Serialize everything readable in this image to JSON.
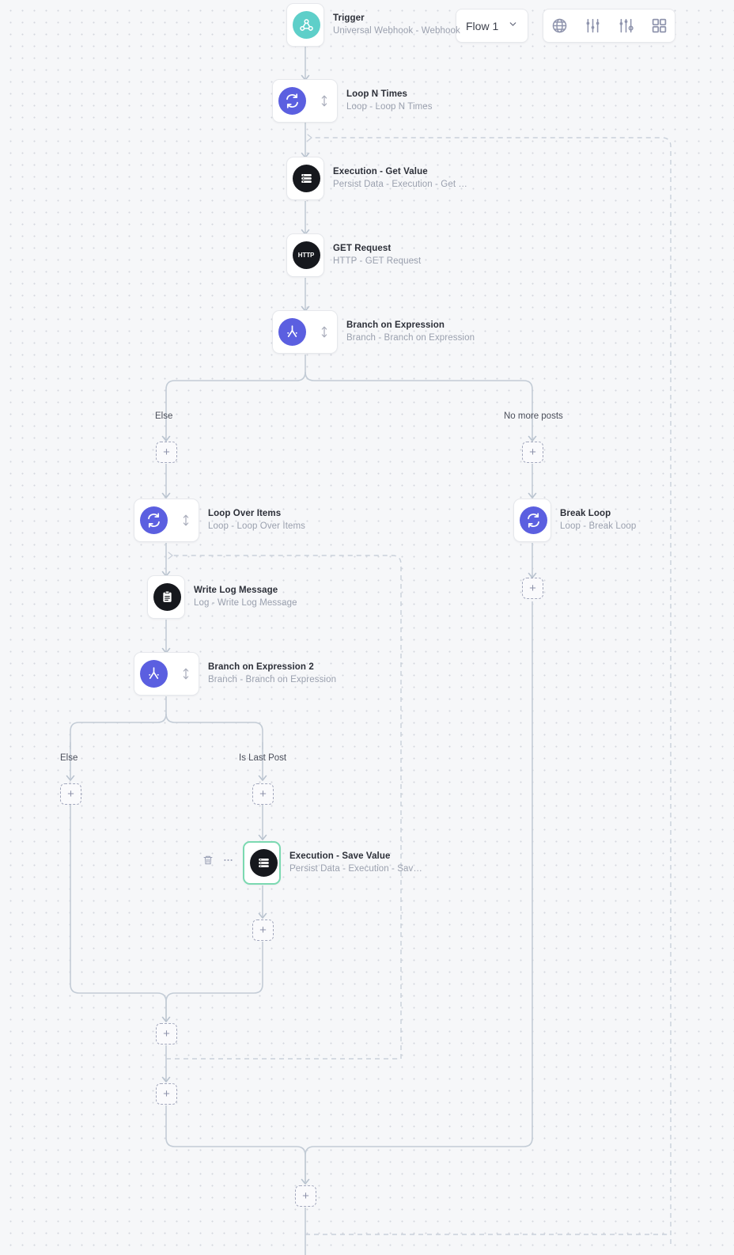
{
  "topbar": {
    "flow_select": {
      "label": "Flow 1",
      "chevron_icon": "chevron-down-icon"
    },
    "tools": [
      {
        "name": "globe-icon",
        "label": "Globe"
      },
      {
        "name": "sliders-icon",
        "label": "Settings"
      },
      {
        "name": "sliders-alt-icon",
        "label": "Advanced settings"
      },
      {
        "name": "grid-icon",
        "label": "Grid view"
      }
    ]
  },
  "nodes": [
    {
      "id": "trigger",
      "title": "Trigger",
      "subtitle": "Universal Webhook - Webhook",
      "icon": "webhook-icon",
      "icon_style": "teal",
      "handle": false,
      "selected": false
    },
    {
      "id": "loop_n_times",
      "title": "Loop N Times",
      "subtitle": "Loop - Loop N Times",
      "icon": "loop-icon",
      "icon_style": "blue",
      "handle": true,
      "selected": false
    },
    {
      "id": "exec_get",
      "title": "Execution - Get Value",
      "subtitle": "Persist Data - Execution - Get …",
      "icon": "database-icon",
      "icon_style": "dark",
      "handle": false,
      "selected": false
    },
    {
      "id": "get_request",
      "title": "GET Request",
      "subtitle": "HTTP - GET Request",
      "icon": "http-icon",
      "icon_style": "dark",
      "handle": false,
      "selected": false
    },
    {
      "id": "branch1",
      "title": "Branch on Expression",
      "subtitle": "Branch - Branch on Expression",
      "icon": "branch-icon",
      "icon_style": "blue",
      "handle": true,
      "selected": false
    },
    {
      "id": "loop_items",
      "title": "Loop Over Items",
      "subtitle": "Loop - Loop Over Items",
      "icon": "loop-icon",
      "icon_style": "blue",
      "handle": true,
      "selected": false
    },
    {
      "id": "break_loop",
      "title": "Break Loop",
      "subtitle": "Loop - Break Loop",
      "icon": "loop-icon",
      "icon_style": "blue",
      "handle": false,
      "selected": false
    },
    {
      "id": "write_log",
      "title": "Write Log Message",
      "subtitle": "Log - Write Log Message",
      "icon": "log-icon",
      "icon_style": "dark",
      "handle": false,
      "selected": false
    },
    {
      "id": "branch2",
      "title": "Branch on Expression 2",
      "subtitle": "Branch - Branch on Expression",
      "icon": "branch-icon",
      "icon_style": "blue",
      "handle": true,
      "selected": false
    },
    {
      "id": "exec_save",
      "title": "Execution - Save Value",
      "subtitle": "Persist Data - Execution - Sav…",
      "icon": "database-icon",
      "icon_style": "dark",
      "handle": false,
      "selected": true
    }
  ],
  "branch_labels": [
    {
      "id": "b1_else",
      "text": "Else"
    },
    {
      "id": "b1_nomore",
      "text": "No more posts"
    },
    {
      "id": "b2_else",
      "text": "Else"
    },
    {
      "id": "b2_lastpost",
      "text": "Is Last Post"
    }
  ],
  "add_buttons": [
    {
      "id": "add_b1_else",
      "glyph": "+"
    },
    {
      "id": "add_b1_nomore",
      "glyph": "+"
    },
    {
      "id": "add_break_next",
      "glyph": "+"
    },
    {
      "id": "add_b2_else",
      "glyph": "+"
    },
    {
      "id": "add_b2_last",
      "glyph": "+"
    },
    {
      "id": "add_after_save",
      "glyph": "+"
    },
    {
      "id": "add_merge_b2",
      "glyph": "+"
    },
    {
      "id": "add_loop_end",
      "glyph": "+"
    },
    {
      "id": "add_final",
      "glyph": "+"
    }
  ],
  "node_tools": [
    {
      "name": "delete-node-button",
      "icon": "trash-icon"
    },
    {
      "name": "more-options-button",
      "icon": "ellipsis-icon"
    }
  ],
  "colors": {
    "canvas_bg": "#f6f7f9",
    "dot": "#d4d7de",
    "edge": "#c3ccd6",
    "dashed_edge": "#c9d0da",
    "accent_blue": "#5b5fe0",
    "accent_teal": "#5ecfc9",
    "selected_border": "#7bd9b1",
    "card_border": "#e6e8ec"
  }
}
